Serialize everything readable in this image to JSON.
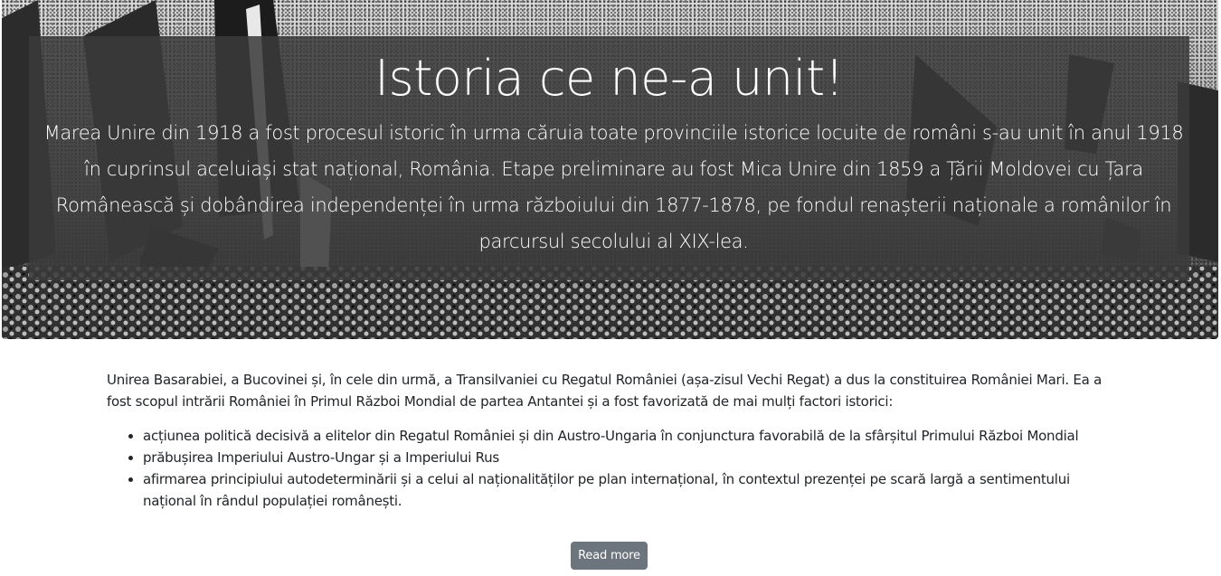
{
  "hero": {
    "title": "Istoria ce ne-a unit!",
    "lead": "Marea Unire din 1918 a fost procesul istoric în urma căruia toate provinciile istorice locuite de români s-au unit în anul 1918 în cuprinsul aceluiași stat național, România. Etape preliminare au fost Mica Unire din 1859 a Țării Moldovei cu Țara Românească și dobândirea independenței în urma războiului din 1877-1878, pe fondul renașterii naționale a românilor în parcursul secolului al XIX-lea."
  },
  "article": {
    "intro": "Unirea Basarabiei, a Bucovinei și, în cele din urmă, a Transilvaniei cu Regatul României (așa-zisul Vechi Regat) a dus la constituirea României Mari. Ea a fost scopul intrării României în Primul Război Mondial de partea Antantei și a fost favorizată de mai mulți factori istorici:",
    "factors": [
      "acțiunea politică decisivă a elitelor din Regatul României și din Austro-Ungaria în conjunctura favorabilă de la sfârșitul Primului Război Mondial",
      "prăbușirea Imperiului Austro-Ungar și a Imperiului Rus",
      "afirmarea principiului autodeterminării și a celui al naționalităților pe plan internațional, în contextul prezenței pe scară largă a sentimentului național în rândul populației românești."
    ]
  },
  "read_more_label": "Read more"
}
